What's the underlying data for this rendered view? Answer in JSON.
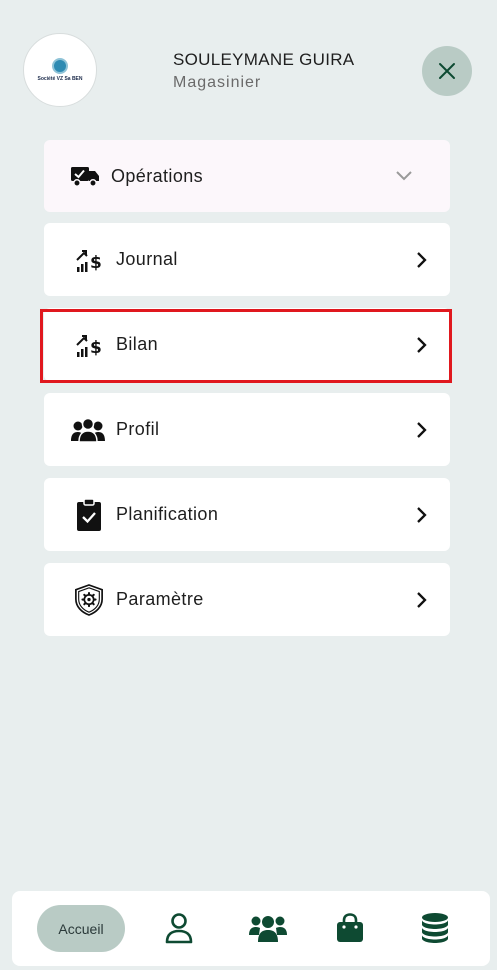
{
  "user": {
    "name": "SOULEYMANE GUIRA",
    "role": "Magasinier",
    "logo_text": "Société VZ Sa BEN"
  },
  "menu": {
    "operations": "Opérations",
    "journal": "Journal",
    "bilan": "Bilan",
    "profil": "Profil",
    "planification": "Planification",
    "parametre": "Paramètre"
  },
  "bottom_nav": {
    "home_label": "Accueil"
  },
  "colors": {
    "background": "#e8eeee",
    "accent": "#0e5a3c",
    "pill": "#b9cbc5",
    "highlight": "#e0181e"
  }
}
